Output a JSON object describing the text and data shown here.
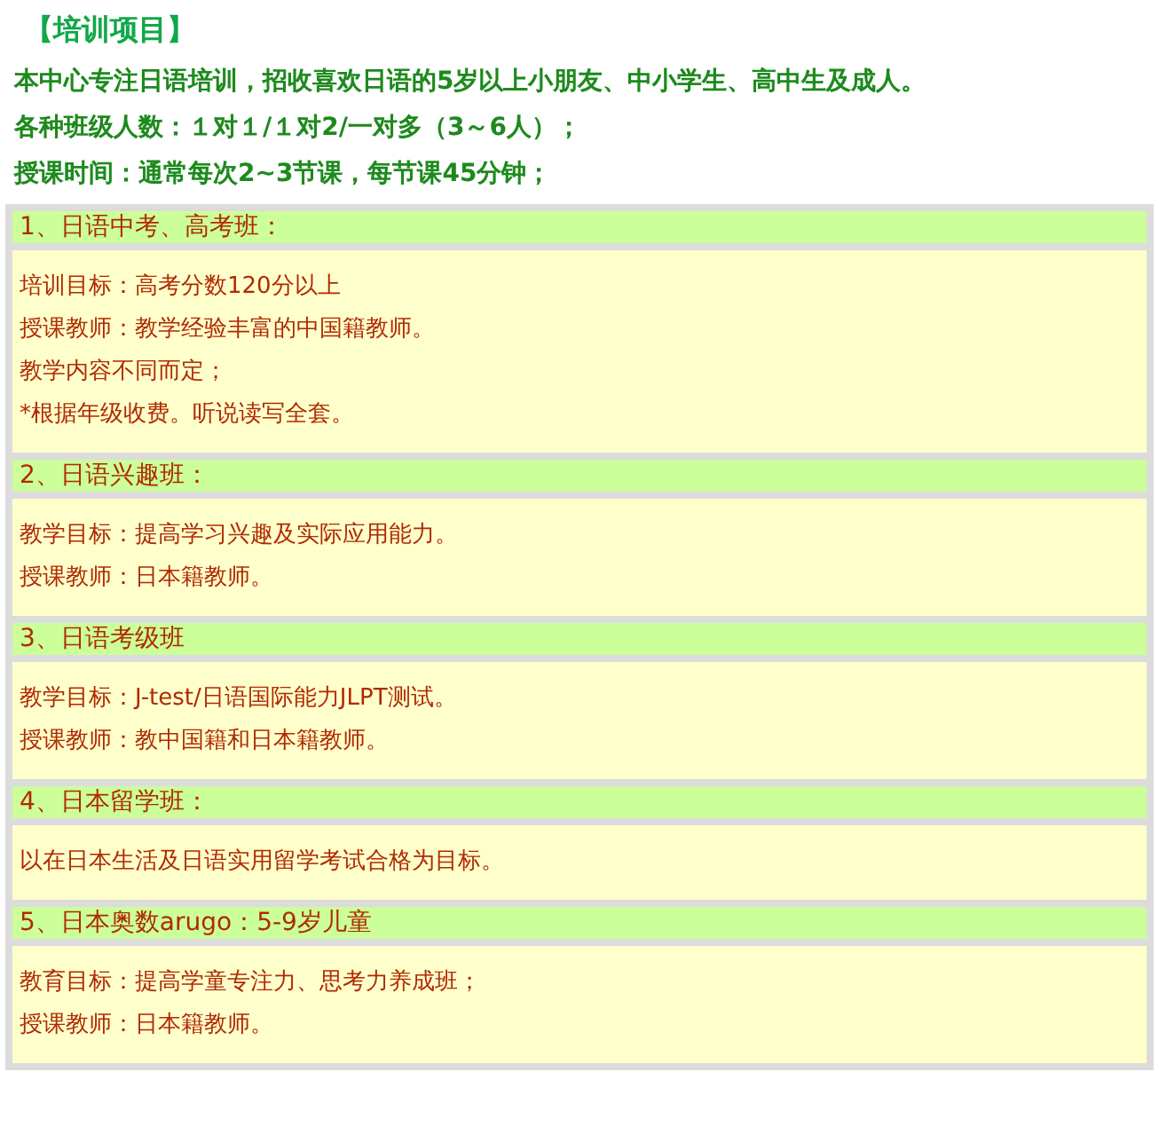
{
  "title": "【培训项目】",
  "intro": [
    "本中心专注日语培训，招收喜欢日语的5岁以上小朋友、中小学生、高中生及成人。",
    "各种班级人数：１对１/１对2/一对多（3～6人）；",
    "授课时间：通常每次2~3节课，每节课45分钟；"
  ],
  "courses": [
    {
      "heading": "1、日语中考、高考班：",
      "lines": [
        "培训目标：高考分数120分以上",
        "授课教师：教学经验丰富的中国籍教师。",
        "教学内容不同而定；",
        "*根据年级收费。听说读写全套。"
      ]
    },
    {
      "heading": "2、日语兴趣班：",
      "lines": [
        "教学目标：提高学习兴趣及实际应用能力。",
        "授课教师：日本籍教师。"
      ]
    },
    {
      "heading": "3、日语考级班",
      "lines": [
        "教学目标：J-test/日语国际能力JLPT测试。",
        "授课教师：教中国籍和日本籍教师。"
      ]
    },
    {
      "heading": "4、日本留学班：",
      "lines": [
        "以在日本生活及日语实用留学考试合格为目标。"
      ]
    },
    {
      "heading": "5、日本奥数arugo：5-9岁儿童",
      "lines": [
        "教育目标：提高学童专注力、思考力养成班；",
        "授课教师：日本籍教师。"
      ]
    }
  ]
}
